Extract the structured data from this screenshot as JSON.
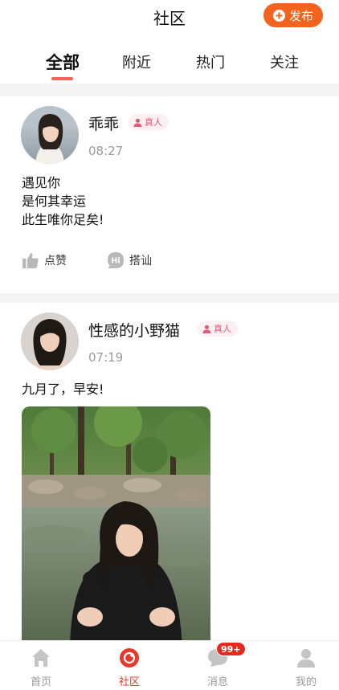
{
  "header": {
    "title": "社区",
    "publish_label": "发布"
  },
  "tabs": [
    {
      "label": "全部",
      "active": true
    },
    {
      "label": "附近",
      "active": false
    },
    {
      "label": "热门",
      "active": false
    },
    {
      "label": "关注",
      "active": false
    }
  ],
  "posts": [
    {
      "nickname": "乖乖",
      "badge": "真人",
      "time": "08:27",
      "text_lines": [
        "遇见你",
        "是何其幸运",
        "此生唯你足矣!"
      ],
      "actions": {
        "like": "点赞",
        "chat": "搭讪",
        "chat_icon_text": "Hi"
      }
    },
    {
      "nickname": "性感的小野猫",
      "badge": "真人",
      "time": "07:19",
      "text_lines": [
        "九月了，早安!"
      ]
    }
  ],
  "bottom_nav": [
    {
      "label": "首页",
      "icon": "home-icon",
      "active": false
    },
    {
      "label": "社区",
      "icon": "community-icon",
      "active": true
    },
    {
      "label": "消息",
      "icon": "message-icon",
      "active": false,
      "badge": "99+"
    },
    {
      "label": "我的",
      "icon": "profile-icon",
      "active": false
    }
  ],
  "colors": {
    "accent": "#f2641e",
    "tab_indicator": "#f0645a",
    "nav_active": "#e8392e",
    "badge_text": "#e35a78"
  }
}
